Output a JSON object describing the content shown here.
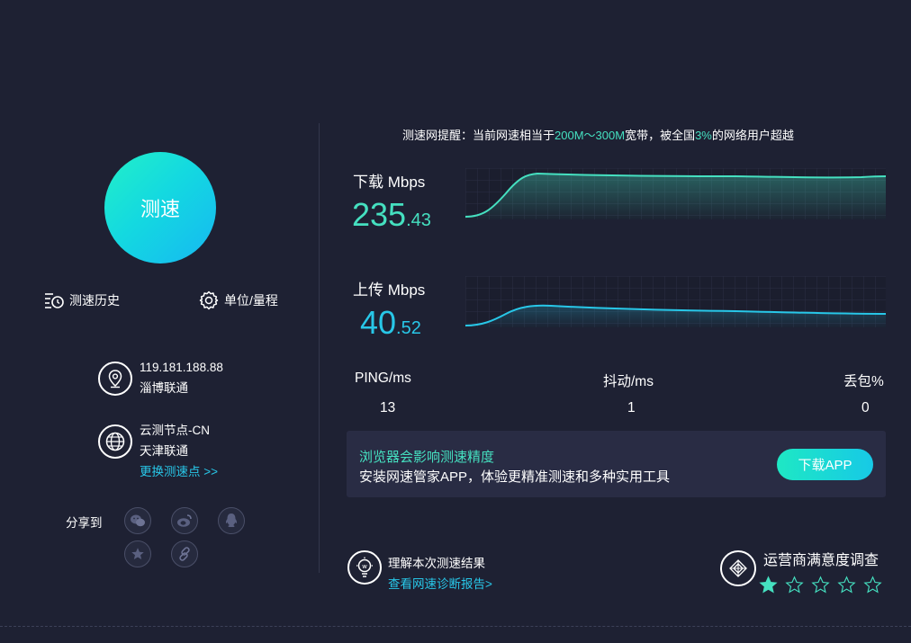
{
  "speed_button": {
    "label": "测速"
  },
  "tools": {
    "history_label": "测速历史",
    "unit_label": "单位/量程"
  },
  "client": {
    "ip": "119.181.188.88",
    "isp": "淄博联通"
  },
  "node": {
    "name": "云测节点-CN",
    "isp": "天津联通",
    "change_link": "更换测速点 >>"
  },
  "share": {
    "label": "分享到",
    "icons": [
      "wechat-icon",
      "weibo-icon",
      "qq-icon",
      "star-icon",
      "link-icon"
    ]
  },
  "notice": {
    "prefix": "测速网提醒：当前网速相当于",
    "bandwidth": "200M～300M",
    "middle": "宽带，被全国",
    "percent": "3%",
    "suffix": "的网络用户超越"
  },
  "download": {
    "label": "下载 Mbps",
    "int": "235",
    "dec": ".43",
    "color": "#45e0c0"
  },
  "upload": {
    "label": "上传 Mbps",
    "int": "40",
    "dec": ".52",
    "color": "#28c7e8"
  },
  "stats": [
    {
      "label": "PING/ms",
      "value": "13"
    },
    {
      "label": "抖动/ms",
      "value": "1"
    },
    {
      "label": "丢包%",
      "value": "0"
    }
  ],
  "banner": {
    "title": "浏览器会影响测速精度",
    "desc": "安装网速管家APP，体验更精准测速和多种实用工具",
    "button": "下载APP"
  },
  "report": {
    "title": "理解本次测速结果",
    "link": "查看网速诊断报告>"
  },
  "survey": {
    "title": "运营商满意度调查",
    "rating": 1,
    "max": 5
  },
  "colors": {
    "background": "#1e2133",
    "accent_green": "#45e0c0",
    "accent_blue": "#28c7e8",
    "banner": "#292c44"
  }
}
